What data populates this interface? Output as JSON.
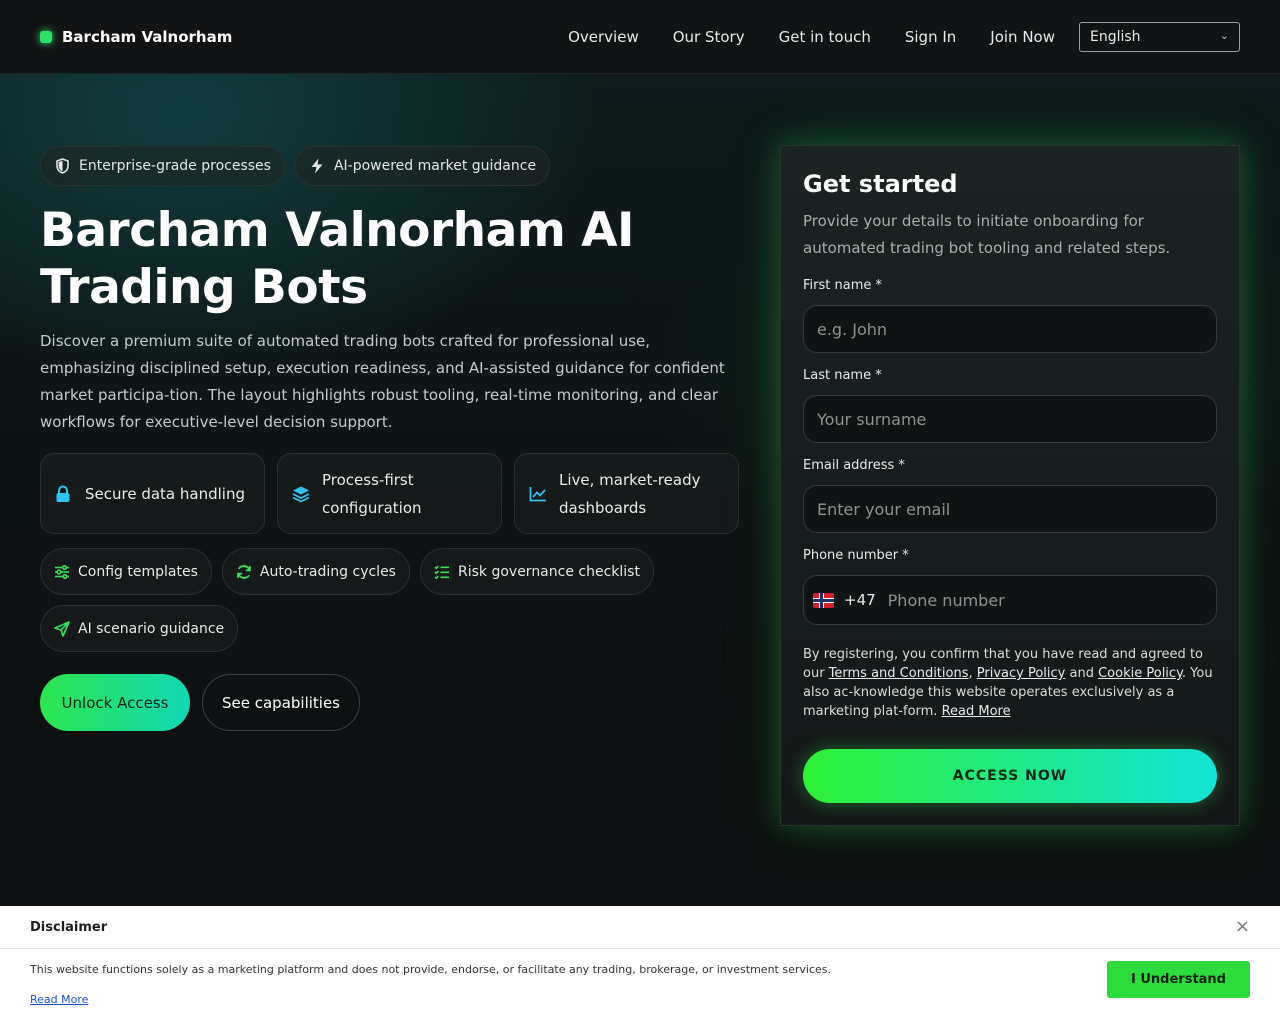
{
  "header": {
    "brand": "Barcham Valnorham",
    "nav": [
      "Overview",
      "Our Story",
      "Get in touch",
      "Sign In",
      "Join Now"
    ],
    "language": "English"
  },
  "hero": {
    "chips": [
      {
        "icon": "shield-icon",
        "label": "Enterprise-grade processes"
      },
      {
        "icon": "bolt-icon",
        "label": "AI-powered market guidance"
      }
    ],
    "title": "Barcham Valnorham AI Trading Bots",
    "description": "Discover a premium suite of automated trading bots crafted for professional use, emphasizing disciplined setup, execution readiness, and AI-assisted guidance for confident market participa-tion. The layout highlights robust tooling, real-time monitoring, and clear workflows for executive-level decision support.",
    "features": [
      {
        "icon": "lock-icon",
        "label": "Secure data handling"
      },
      {
        "icon": "layers-icon",
        "label": "Process-first configuration"
      },
      {
        "icon": "chart-line-icon",
        "label": "Live, market-ready dashboards"
      }
    ],
    "pills": [
      {
        "icon": "sliders-icon",
        "label": "Config templates"
      },
      {
        "icon": "refresh-icon",
        "label": "Auto-trading cycles"
      },
      {
        "icon": "checklist-icon",
        "label": "Risk governance checklist"
      },
      {
        "icon": "send-icon",
        "label": "AI scenario guidance"
      }
    ],
    "cta_primary": "Unlock Access",
    "cta_secondary": "See capabilities"
  },
  "form": {
    "title": "Get started",
    "subtitle": "Provide your details to initiate onboarding for automated trading bot tooling and related steps.",
    "first_name_label": "First name *",
    "first_name_placeholder": "e.g. John",
    "last_name_label": "Last name *",
    "last_name_placeholder": "Your surname",
    "email_label": "Email address *",
    "email_placeholder": "Enter your email",
    "phone_label": "Phone number *",
    "phone_dial_code": "+47",
    "phone_placeholder": "Phone number",
    "legal_before": "By registering, you confirm that you have read and agreed to our ",
    "terms_link": "Terms and Conditions",
    "comma": ", ",
    "privacy_link": "Privacy Policy",
    "and_text": " and ",
    "cookie_link": "Cookie Policy",
    "legal_after": ". You also ac-knowledge this website operates exclusively as a marketing plat-form. ",
    "read_more_link": "Read More",
    "submit_label": "ACCESS NOW"
  },
  "disclaimer": {
    "title": "Disclaimer",
    "close": "×",
    "text": "This website functions solely as a marketing platform and does not provide, endorse, or facilitate any trading, brokerage, or investment services.",
    "read_more": "Read More",
    "accept_label": "I Understand"
  },
  "colors": {
    "accent_green": "#2ee54e",
    "accent_cyan": "#12d8b6",
    "background": "#0d0f10"
  }
}
